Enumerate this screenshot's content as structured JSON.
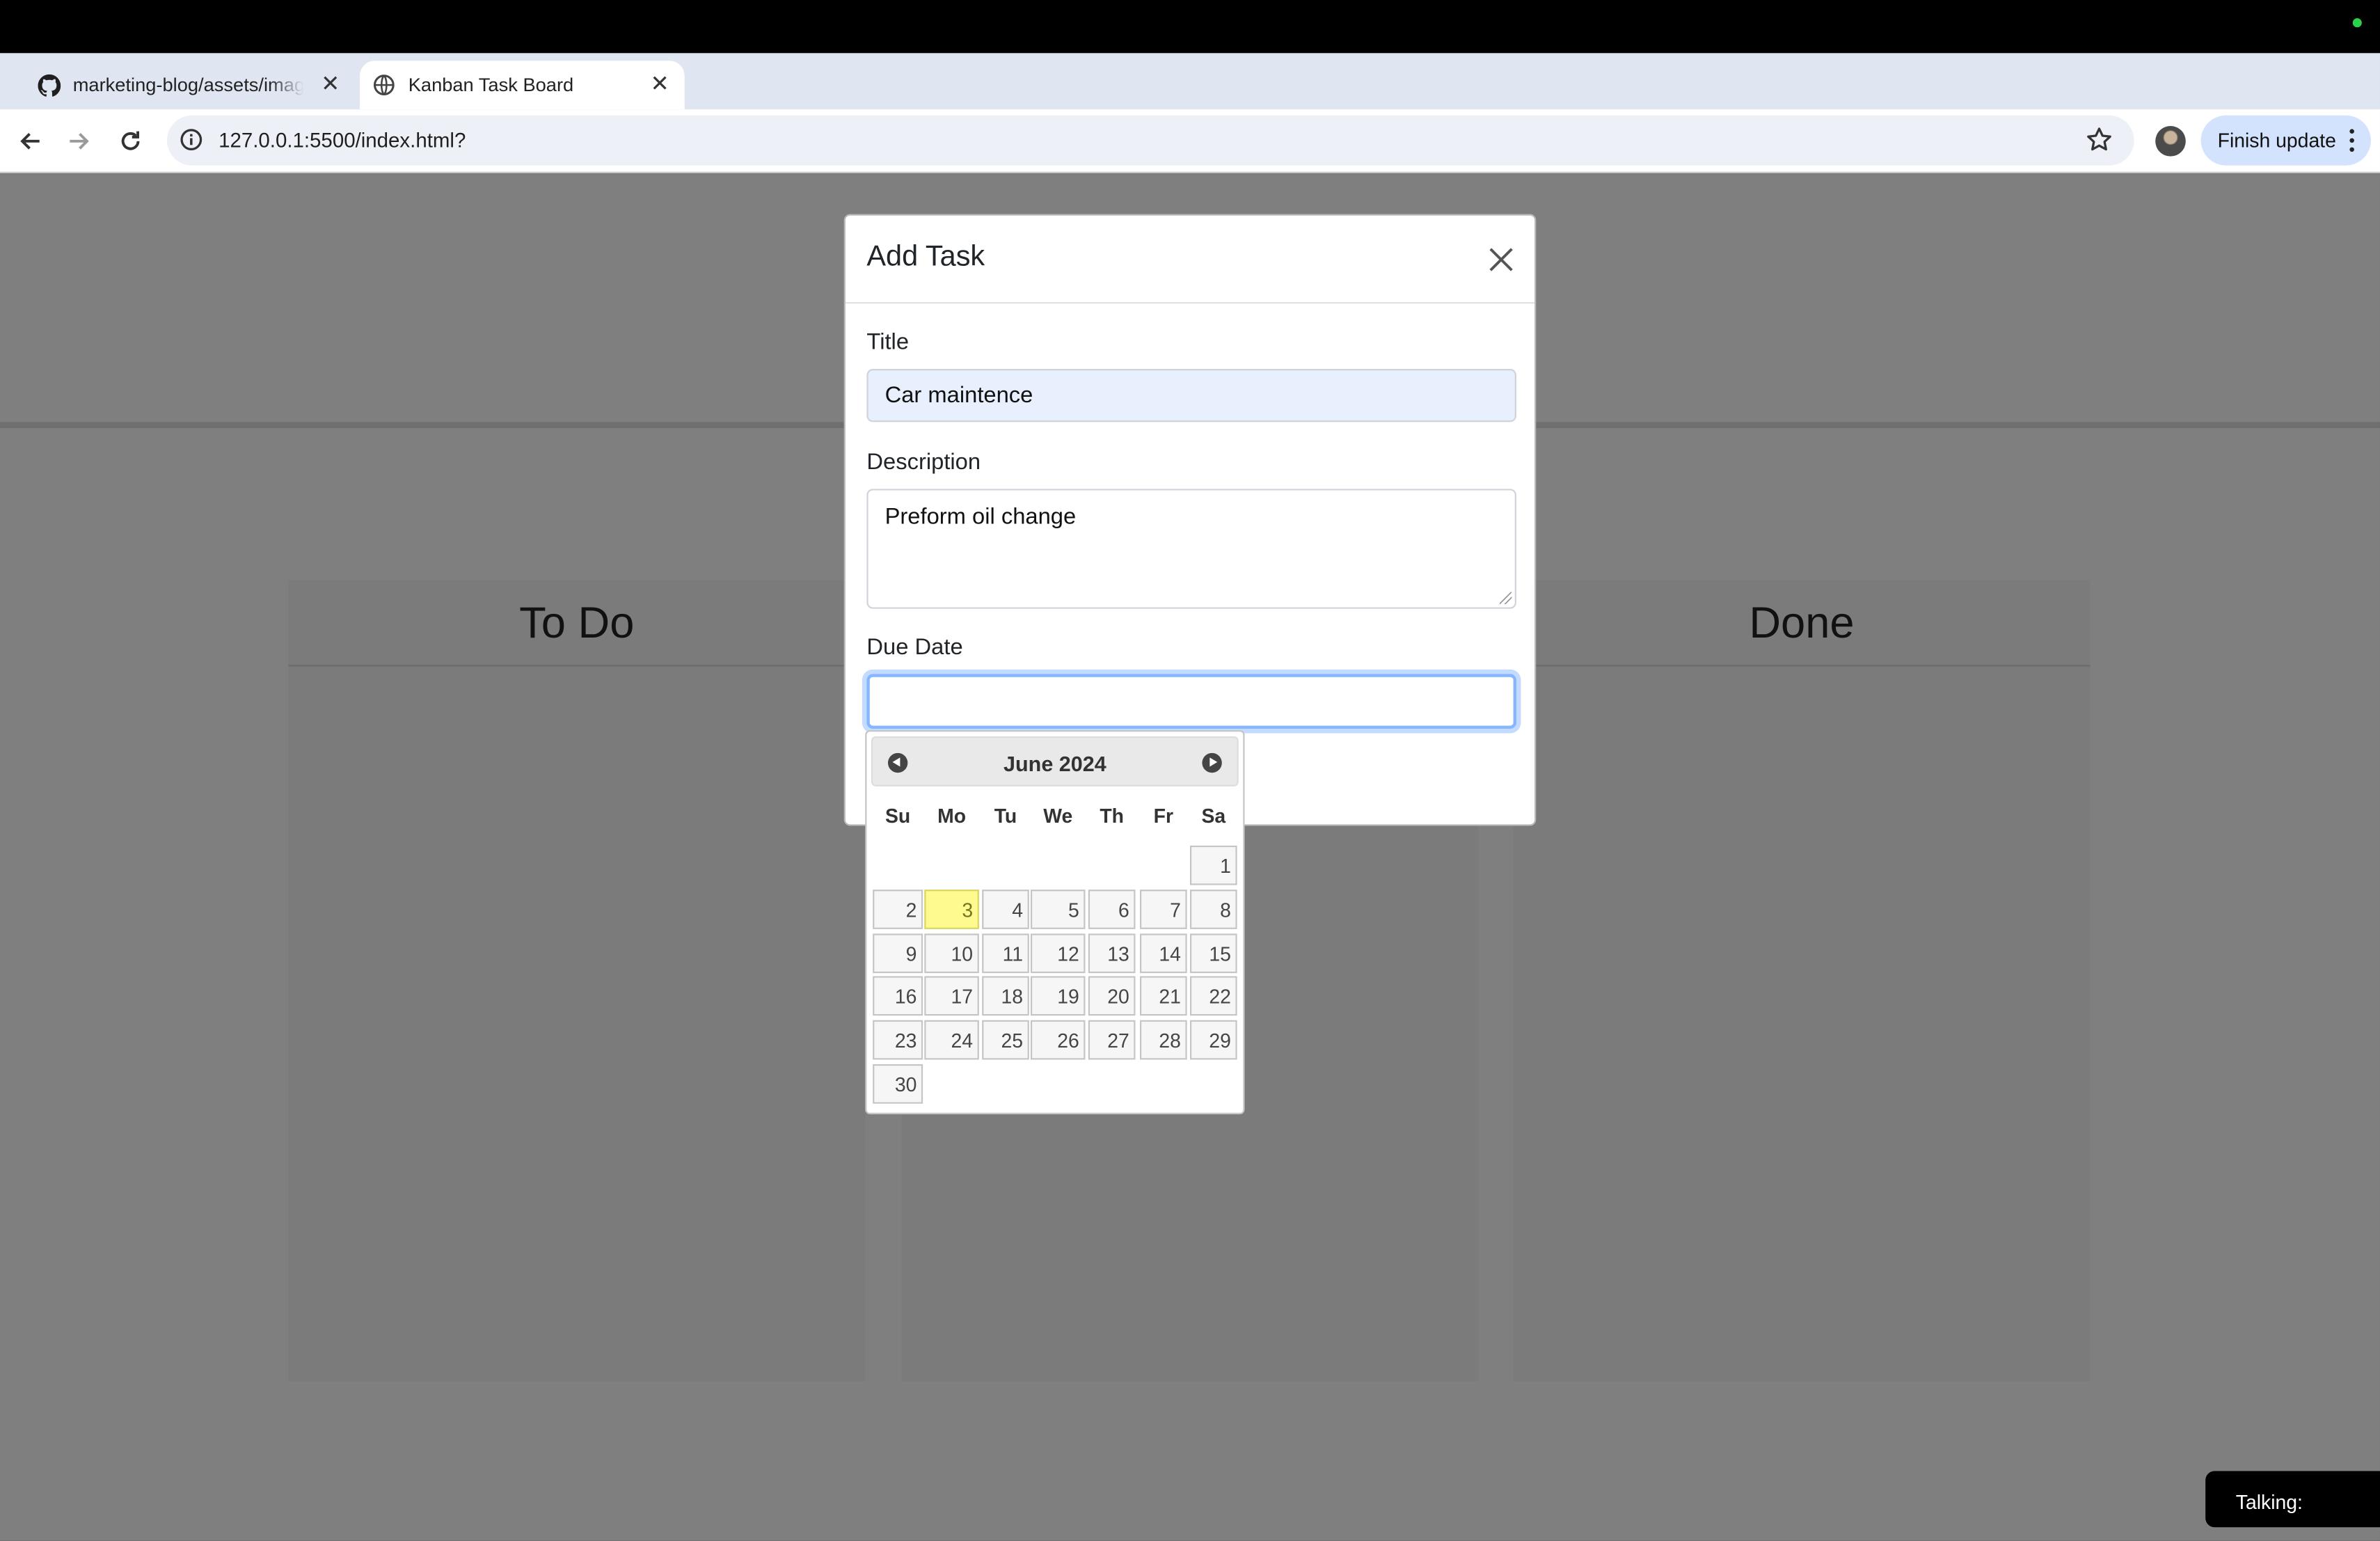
{
  "browser": {
    "tabs": [
      {
        "title": "marketing-blog/assets/images",
        "icon": "github-icon"
      },
      {
        "title": "Kanban Task Board",
        "icon": "globe-icon"
      }
    ],
    "url": "127.0.0.1:5500/index.html?",
    "finish_update_label": "Finish update"
  },
  "board": {
    "columns": [
      {
        "title": "To Do"
      },
      {
        "title": ""
      },
      {
        "title": "Done"
      }
    ]
  },
  "modal": {
    "title": "Add Task",
    "fields": {
      "title_label": "Title",
      "title_value": "Car maintence",
      "description_label": "Description",
      "description_value": "Preform oil change",
      "due_date_label": "Due Date",
      "due_date_value": ""
    }
  },
  "datepicker": {
    "month_label": "June 2024",
    "weekdays": [
      "Su",
      "Mo",
      "Tu",
      "We",
      "Th",
      "Fr",
      "Sa"
    ],
    "first_weekday_index": 6,
    "days_in_month": 30,
    "highlighted_day": 3
  },
  "overlay": {
    "talking_label": "Talking:"
  },
  "colors": {
    "today_highlight": "#fffa90",
    "focus_ring": "#86b7fe",
    "autofill_bg": "#e8f0fe"
  }
}
